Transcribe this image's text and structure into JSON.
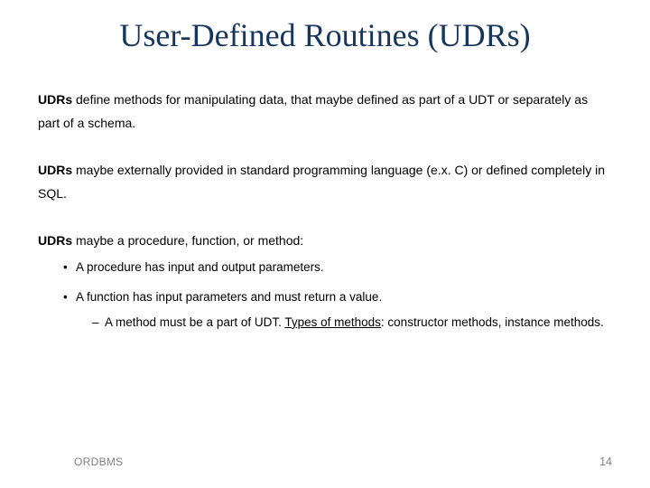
{
  "title": "User-Defined Routines (UDRs)",
  "p1_strong": "UDRs",
  "p1_rest": " define methods for manipulating data, that maybe defined as part of a UDT or separately as part of a schema.",
  "p2_strong": "UDRs",
  "p2_rest": " maybe externally provided in standard programming language (e.x. C) or defined completely in SQL.",
  "p3_strong": "UDRs",
  "p3_rest": " maybe a procedure, function, or method:",
  "b1": "A procedure has input and output parameters.",
  "b2": "A function has input parameters and must return a value.",
  "sub_pre": "A method must be a part of UDT. ",
  "sub_u": "Types of methods",
  "sub_post": ": constructor methods, instance methods.",
  "footer_left": "ORDBMS",
  "footer_right": "14"
}
